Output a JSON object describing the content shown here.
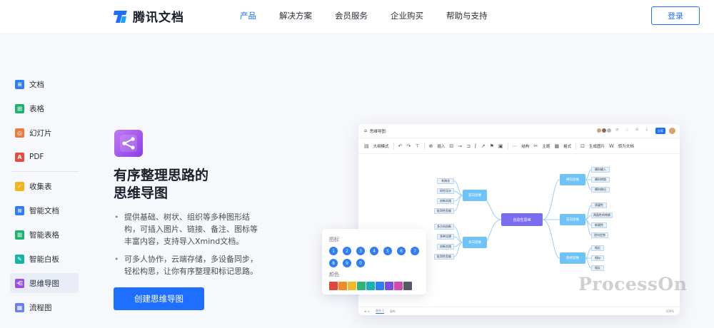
{
  "header": {
    "brand": "腾讯文档",
    "nav": [
      {
        "label": "产品",
        "active": true
      },
      {
        "label": "解决方案",
        "active": false
      },
      {
        "label": "会员服务",
        "active": false
      },
      {
        "label": "企业购买",
        "active": false
      },
      {
        "label": "帮助与支持",
        "active": false
      }
    ],
    "login": "登录"
  },
  "sidebar": {
    "items": [
      {
        "label": "文档",
        "icon": "doc-icon",
        "color": "#2f7ef5",
        "glyph": "≡"
      },
      {
        "label": "表格",
        "icon": "sheet-icon",
        "color": "#19b46e",
        "glyph": "⊞"
      },
      {
        "label": "幻灯片",
        "icon": "slides-icon",
        "color": "#f07a3c",
        "glyph": "◎"
      },
      {
        "label": "PDF",
        "icon": "pdf-icon",
        "color": "#ea4b3e",
        "glyph": "A"
      },
      {
        "label": "收集表",
        "icon": "form-icon",
        "color": "#f4b420",
        "glyph": "✓"
      },
      {
        "label": "智能文档",
        "icon": "smart-doc-icon",
        "color": "#2f7ef5",
        "glyph": "≡"
      },
      {
        "label": "智能表格",
        "icon": "smart-sheet-icon",
        "color": "#19b46e",
        "glyph": "⊞"
      },
      {
        "label": "智能白板",
        "icon": "whiteboard-icon",
        "color": "#14b4a6",
        "glyph": "✎"
      },
      {
        "label": "思维导图",
        "icon": "mindmap-icon",
        "color": "#9a4de8",
        "glyph": "⋲"
      },
      {
        "label": "流程图",
        "icon": "flowchart-icon",
        "color": "#6a7ff2",
        "glyph": "▦"
      }
    ]
  },
  "hero": {
    "title_line1": "有序整理思路的",
    "title_line2": "思维导图",
    "bullet1": "提供基础、树状、组织等多种图形结构，可插入图片、链接、备注、图标等丰富内容，支持导入Xmind文档。",
    "bullet2": "可多人协作，云端存储，多设备同步，轻松构思，让你有序整理和标记思路。",
    "cta": "创建思维导图"
  },
  "mockup": {
    "title": "思维导图",
    "share": "分享",
    "toolbar": {
      "outline": "大纲模式",
      "insert": "插入",
      "structure": "结构",
      "theme": "主题",
      "format": "格式",
      "export_image": "生成图片",
      "to_doc": "转为文档"
    },
    "mindmap": {
      "root": "创造性思维",
      "left_top": "逆向思维",
      "left_top_children": [
        "系统化",
        "研究设计",
        "创新实践",
        "批判性思维"
      ],
      "left_bottom": "多向思维",
      "left_bottom_children": [
        "多方向创新",
        "多种设想",
        "创新实践",
        "批判性思维"
      ],
      "right_top": "横向思维",
      "right_top_children": [
        "横向输入",
        "横向转换",
        "横向移出"
      ],
      "right_mid": "逆向思维",
      "right_mid_children": [
        "质疑性",
        "两面性的转换",
        "新颖性",
        "逆向定势"
      ],
      "right_bottom": "联想思维",
      "right_bottom_children": [
        "相近",
        "相似",
        "相反"
      ]
    },
    "bottom_tabs": [
      "画布 1",
      "画布"
    ],
    "zoom": "100%"
  },
  "palette": {
    "icons_label": "图标",
    "numbers_row1": [
      "1",
      "2",
      "3",
      "4",
      "5",
      "6",
      "7"
    ],
    "numbers_row2": [
      "8",
      "9",
      "0"
    ],
    "colors_label": "颜色",
    "colors": [
      "#e2453c",
      "#f08a2c",
      "#f4b92a",
      "#2fb37a",
      "#1ab0b8",
      "#2f7ef5",
      "#7a4ee6",
      "#d44bb0",
      "#555a63"
    ]
  },
  "watermark": "ProcessOn"
}
